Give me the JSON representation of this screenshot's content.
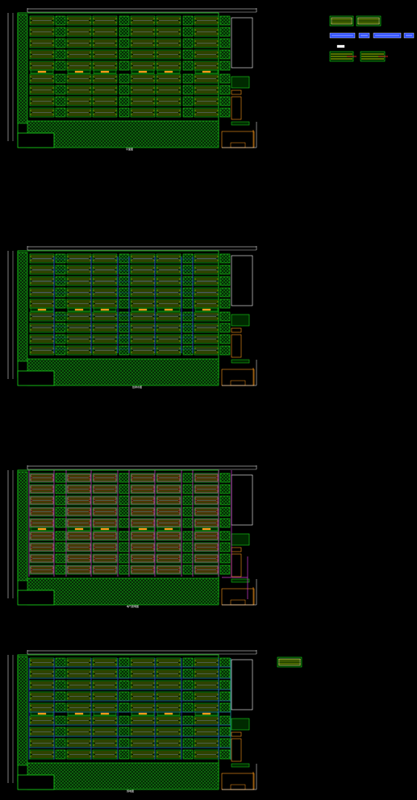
{
  "drawing": {
    "colors": {
      "background": "#000000",
      "green": "#18d818",
      "yellow": "#e8e800",
      "white": "#ffffff",
      "blue": "#2b4cff",
      "magenta": "#d23cd2",
      "orange": "#ff9a1a",
      "red": "#ff2a2a",
      "cyan": "#20d0d0"
    },
    "sheets": [
      {
        "id": "plan-1",
        "caption": "平面图",
        "overlay": "none"
      },
      {
        "id": "plan-2",
        "caption": "给排水图",
        "overlay": "blue"
      },
      {
        "id": "plan-3",
        "caption": "电气照明图",
        "overlay": "magenta"
      },
      {
        "id": "plan-4",
        "caption": "弱电图",
        "overlay": "blue-grid"
      }
    ],
    "thumbnails": [
      {
        "id": "thumb-elevation-1"
      },
      {
        "id": "thumb-elevation-2"
      },
      {
        "id": "thumb-section-1"
      },
      {
        "id": "thumb-section-2"
      },
      {
        "id": "thumb-section-3"
      },
      {
        "id": "thumb-section-4"
      },
      {
        "id": "thumb-detail-1"
      },
      {
        "id": "thumb-detail-2"
      },
      {
        "id": "thumb-detail-3"
      }
    ]
  }
}
